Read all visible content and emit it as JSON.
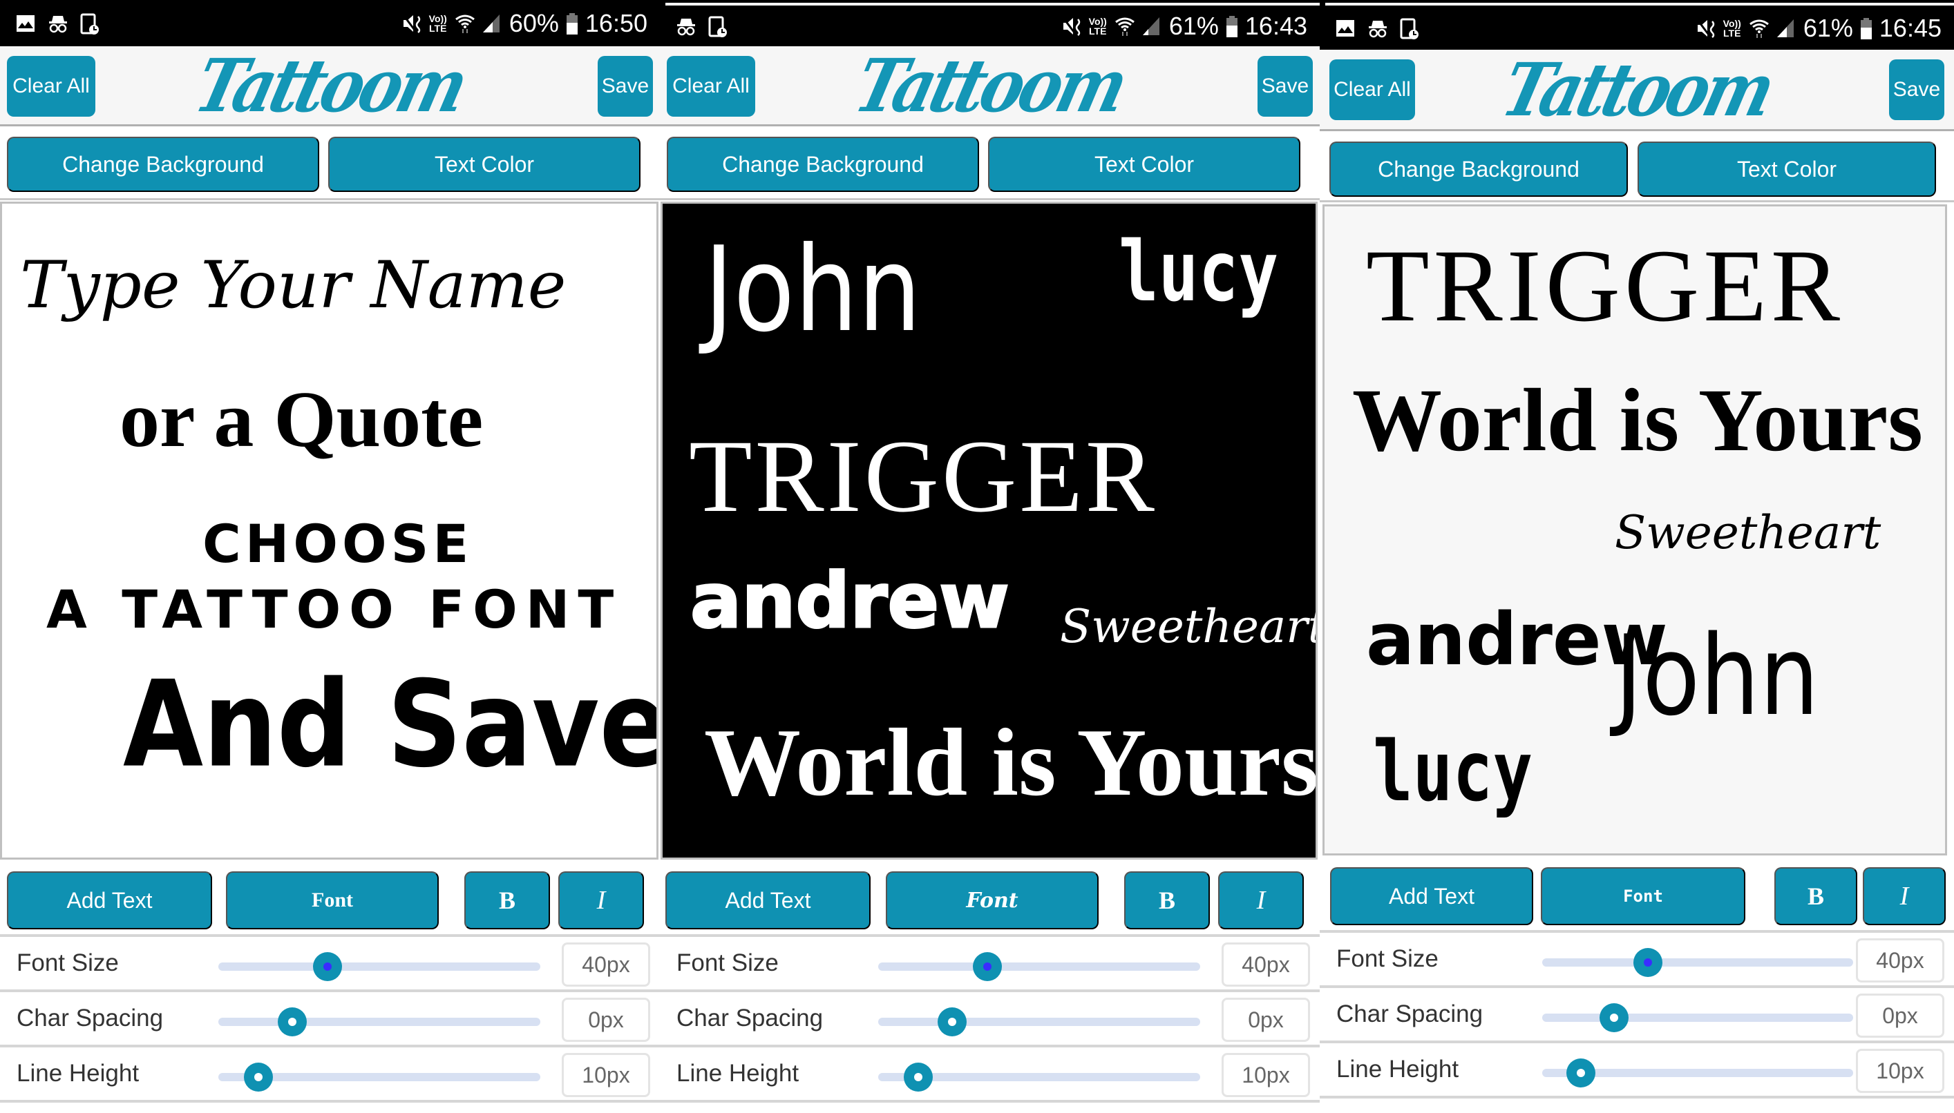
{
  "accent_color": "#0f91b2",
  "panels": [
    {
      "status": {
        "battery": "60%",
        "time": "16:50",
        "icons_left": [
          "gallery-icon",
          "incognito-icon",
          "tablet-clock-icon"
        ],
        "icons_right": [
          "mute-icon",
          "volte-icon",
          "wifi-icon",
          "signal-icon",
          "battery-icon"
        ],
        "volte": [
          "Vo))",
          "LTE"
        ]
      },
      "header": {
        "clear_label": "Clear All",
        "logo": "Tattoom",
        "save_label": "Save"
      },
      "actions": {
        "background_label": "Change Background",
        "text_color_label": "Text Color"
      },
      "canvas": {
        "background": "#ffffff",
        "text_color": "#000000",
        "texts": [
          "Type Your Name",
          "or a Quote",
          "CHOOSE",
          "A TATTOO FONT",
          "And Save"
        ]
      },
      "toolbar": {
        "add_label": "Add Text",
        "font_label": "Font",
        "bold_label": "B",
        "italic_label": "I"
      },
      "sliders": [
        {
          "label": "Font Size",
          "value": "40px",
          "fraction": 0.34
        },
        {
          "label": "Char Spacing",
          "value": "0px",
          "fraction": 0.23
        },
        {
          "label": "Line Height",
          "value": "10px",
          "fraction": 0.125
        }
      ]
    },
    {
      "status": {
        "battery": "61%",
        "time": "16:43",
        "icons_left": [
          "incognito-icon",
          "tablet-clock-icon"
        ],
        "volte": [
          "Vo))",
          "LTE"
        ]
      },
      "header": {
        "clear_label": "Clear All",
        "logo": "Tattoom",
        "save_label": "Save"
      },
      "actions": {
        "background_label": "Change Background",
        "text_color_label": "Text Color"
      },
      "canvas": {
        "background": "#000000",
        "text_color": "#ffffff",
        "texts": [
          "John",
          "lucy",
          "TRIGGER",
          "andrew",
          "Sweetheart",
          "World is Yours"
        ]
      },
      "toolbar": {
        "add_label": "Add Text",
        "font_label": "Font",
        "bold_label": "B",
        "italic_label": "I"
      },
      "sliders": [
        {
          "label": "Font Size",
          "value": "40px",
          "fraction": 0.34
        },
        {
          "label": "Char Spacing",
          "value": "0px",
          "fraction": 0.23
        },
        {
          "label": "Line Height",
          "value": "10px",
          "fraction": 0.125
        }
      ]
    },
    {
      "status": {
        "battery": "61%",
        "time": "16:45",
        "icons_left": [
          "gallery-icon",
          "incognito-icon",
          "tablet-clock-icon"
        ],
        "volte": [
          "Vo))",
          "LTE"
        ]
      },
      "header": {
        "clear_label": "Clear All",
        "logo": "Tattoom",
        "save_label": "Save"
      },
      "actions": {
        "background_label": "Change Background",
        "text_color_label": "Text Color"
      },
      "canvas": {
        "background": "#f7f7f7",
        "text_color": "#000000",
        "texts": [
          "TRIGGER",
          "World is Yours",
          "Sweetheart",
          "andrew",
          "John",
          "lucy"
        ]
      },
      "toolbar": {
        "add_label": "Add Text",
        "font_label": "Font",
        "bold_label": "B",
        "italic_label": "I"
      },
      "sliders": [
        {
          "label": "Font Size",
          "value": "40px",
          "fraction": 0.34
        },
        {
          "label": "Char Spacing",
          "value": "0px",
          "fraction": 0.23
        },
        {
          "label": "Line Height",
          "value": "10px",
          "fraction": 0.125
        }
      ]
    }
  ]
}
